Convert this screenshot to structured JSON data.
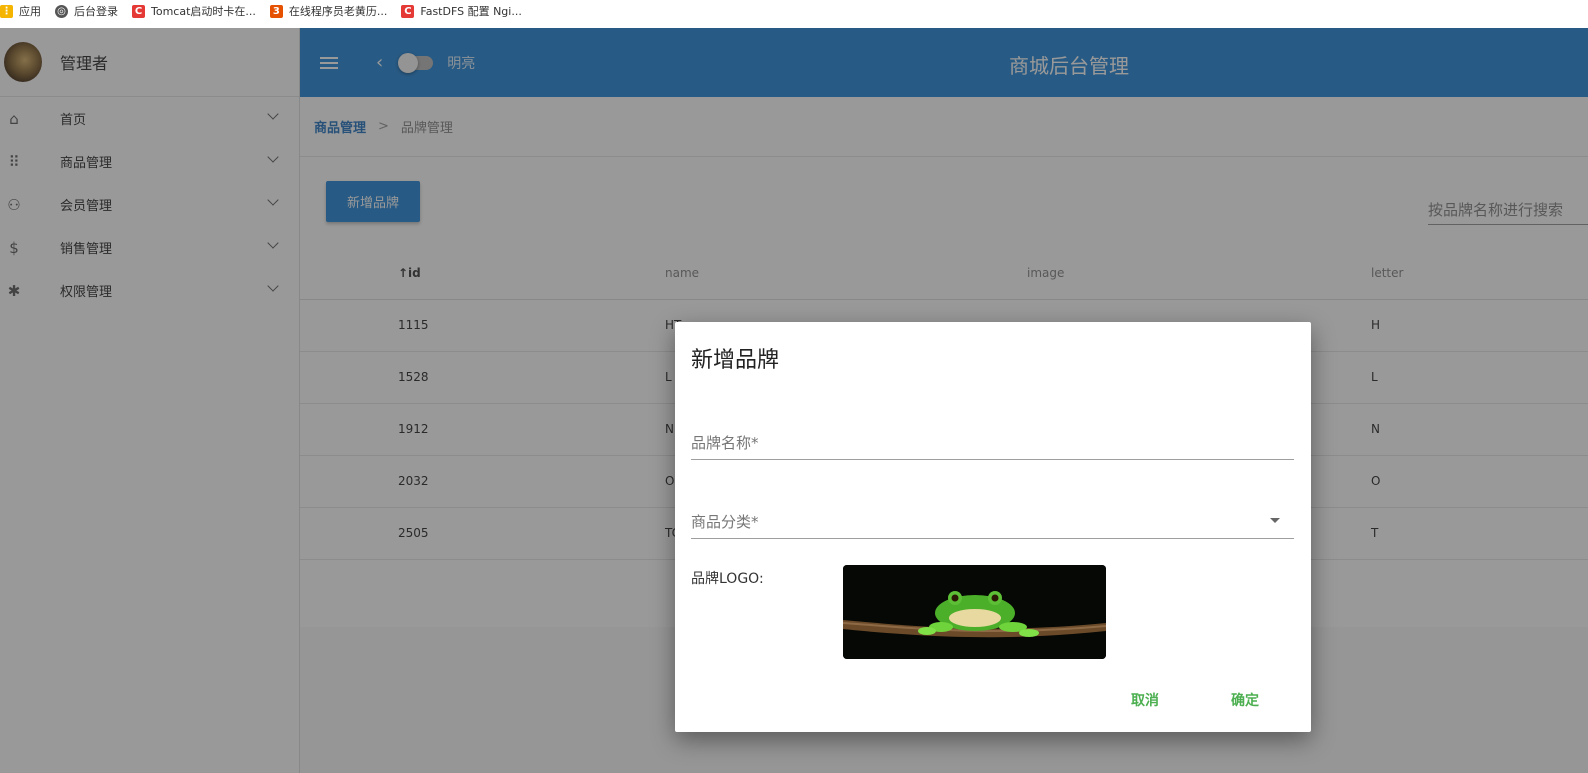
{
  "bookmarks": [
    {
      "label": "应用",
      "icon": "apps-grid-icon",
      "color": "#f4b400"
    },
    {
      "label": "后台登录",
      "icon": "globe-icon",
      "color": "#555555"
    },
    {
      "label": "Tomcat启动时卡在...",
      "icon": "csdn-c-icon",
      "color": "#e53935"
    },
    {
      "label": "在线程序员老黄历...",
      "icon": "calendar-3-icon",
      "color": "#e65100"
    },
    {
      "label": "FastDFS 配置 Ngi...",
      "icon": "csdn-c-icon",
      "color": "#e53935"
    }
  ],
  "profile": {
    "name": "管理者"
  },
  "menu": [
    {
      "label": "首页",
      "icon": "home-icon"
    },
    {
      "label": "商品管理",
      "icon": "grid-apps-icon"
    },
    {
      "label": "会员管理",
      "icon": "people-icon"
    },
    {
      "label": "销售管理",
      "icon": "dollar-icon"
    },
    {
      "label": "权限管理",
      "icon": "gear-icon"
    }
  ],
  "topbar": {
    "mode_label": "明亮",
    "title": "商城后台管理",
    "color": "#2e8bd8"
  },
  "breadcrumb": {
    "parent": "商品管理",
    "current": "品牌管理"
  },
  "toolbar": {
    "add_label": "新增品牌",
    "search_placeholder": "按品牌名称进行搜索"
  },
  "table": {
    "headers": [
      "↑id",
      "name",
      "image",
      "letter"
    ],
    "rows": [
      {
        "id": "1115",
        "name": "HT",
        "letter": "H"
      },
      {
        "id": "1528",
        "name": "L",
        "letter": "L"
      },
      {
        "id": "1912",
        "name": "NE",
        "letter": "N"
      },
      {
        "id": "2032",
        "name": "OP",
        "letter": "O"
      },
      {
        "id": "2505",
        "name": "TC",
        "letter": "T"
      }
    ]
  },
  "dialog": {
    "title": "新增品牌",
    "brand_name_label": "品牌名称*",
    "category_label": "商品分类*",
    "logo_label": "品牌LOGO:",
    "cancel_label": "取消",
    "confirm_label": "确定"
  }
}
